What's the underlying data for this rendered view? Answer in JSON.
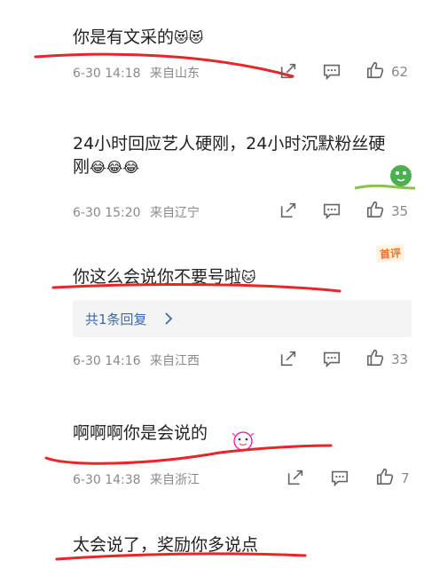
{
  "colors": {
    "text": "#222222",
    "meta": "#8a8a8a",
    "underline": "#e8262a",
    "link": "#3b6aa8",
    "badge": "#e8722d"
  },
  "comments": [
    {
      "text": "你是有文采的",
      "emoji": "😻😻",
      "date": "6-30",
      "time": "14:18",
      "location": "来自山东",
      "likes": "62"
    },
    {
      "text_line1": "24小时回应艺人硬刚，24小时沉默粉丝硬",
      "text_line2": "刚",
      "emoji": "😂😂😂",
      "date": "6-30",
      "time": "15:20",
      "location": "来自辽宁",
      "likes": "35"
    },
    {
      "text": "你这么会说你不要号啦",
      "emoji": "🐱",
      "badge": "首评",
      "reply": "共1条回复",
      "date": "6-30",
      "time": "14:16",
      "location": "来自江西",
      "likes": "33"
    },
    {
      "text": "啊啊啊你是会说的",
      "date": "6-30",
      "time": "14:38",
      "location": "来自浙江",
      "likes": "7"
    },
    {
      "text": "太会说了，奖励你多说点"
    }
  ],
  "icons": {
    "share": "share-icon",
    "comment": "comment-icon",
    "like": "thumbs-up-icon",
    "chevron": "chevron-right-icon"
  }
}
